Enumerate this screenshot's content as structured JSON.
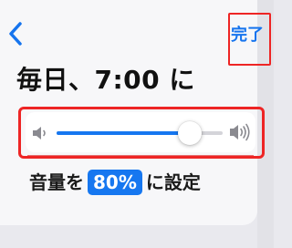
{
  "nav": {
    "back_icon": "chevron-left-icon",
    "done_label": "完了"
  },
  "title": "毎日、7:00 に",
  "volume_slider": {
    "level_percent": 80,
    "low_icon": "speaker-low-icon",
    "high_icon": "speaker-high-icon"
  },
  "caption": {
    "prefix": "音量を",
    "value": "80%",
    "suffix": "に設定"
  },
  "colors": {
    "accent": "#1677f0",
    "highlight": "#ee2525"
  }
}
